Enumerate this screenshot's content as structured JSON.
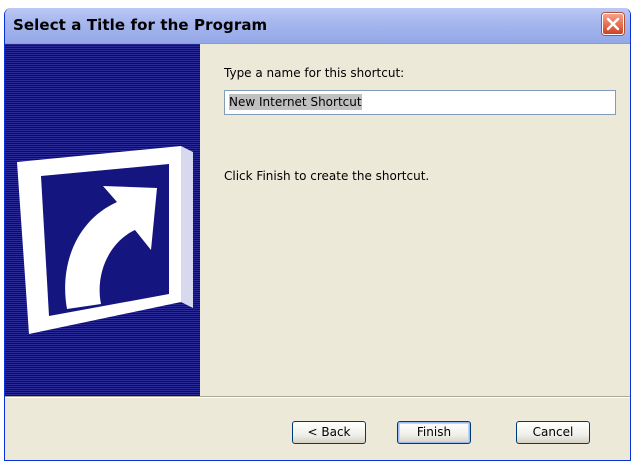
{
  "window": {
    "title": "Select a Title for the Program"
  },
  "content": {
    "prompt_label": "Type a name for this shortcut:",
    "name_value": "New Internet Shortcut",
    "finish_note": "Click Finish to create the shortcut."
  },
  "buttons": {
    "back": "< Back",
    "finish": "Finish",
    "cancel": "Cancel"
  },
  "icons": {
    "close": "close-icon",
    "wizard": "shortcut-arrow-icon"
  },
  "colors": {
    "titlebar": "#a7b7ee",
    "panel": "#1a1a80",
    "face": "#ece9d8",
    "close": "#e3694a"
  }
}
